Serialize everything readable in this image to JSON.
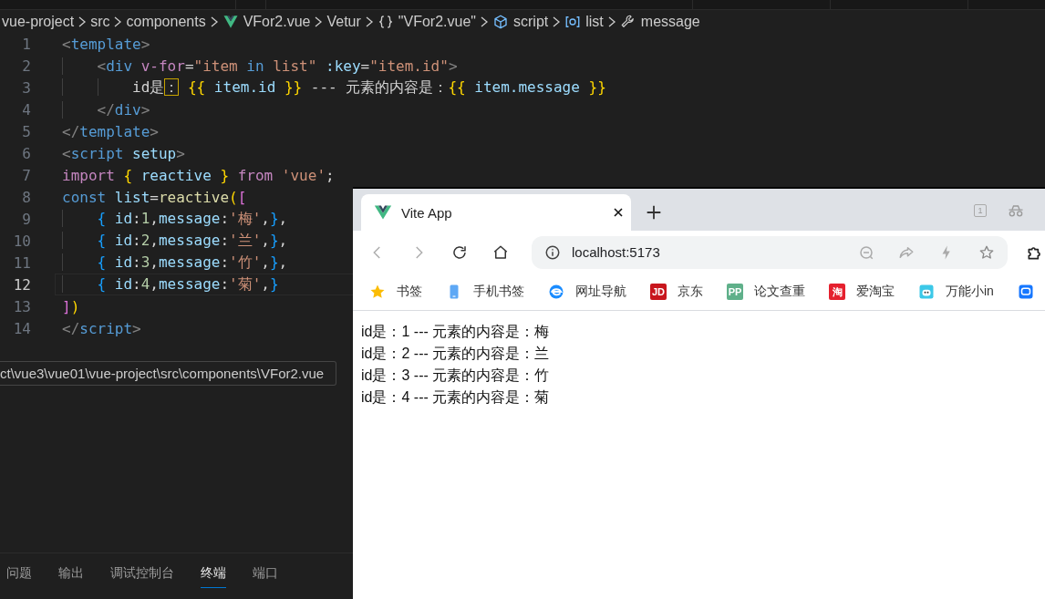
{
  "breadcrumb": [
    {
      "kind": "plain",
      "label": "vue-project"
    },
    {
      "kind": "plain",
      "label": "src"
    },
    {
      "kind": "plain",
      "label": "components"
    },
    {
      "kind": "vue",
      "label": "VFor2.vue"
    },
    {
      "kind": "plain",
      "label": "Vetur"
    },
    {
      "kind": "braces",
      "label": "\"VFor2.vue\""
    },
    {
      "kind": "cube",
      "label": "script"
    },
    {
      "kind": "array",
      "label": "list"
    },
    {
      "kind": "wrench",
      "label": "message"
    }
  ],
  "editor": {
    "lines": [
      {
        "number": "1",
        "current": false,
        "tokens": [
          {
            "kind": "bracket",
            "text": "<"
          },
          {
            "kind": "tag",
            "text": "template"
          },
          {
            "kind": "bracket",
            "text": ">"
          }
        ]
      },
      {
        "number": "2",
        "current": false,
        "tokens": [
          {
            "kind": "bracket",
            "text": "    <"
          },
          {
            "kind": "tag",
            "text": "div "
          },
          {
            "kind": "directive",
            "text": "v-for"
          },
          {
            "kind": "plain",
            "text": "="
          },
          {
            "kind": "string",
            "text": "\"item "
          },
          {
            "kind": "keyword",
            "text": "in"
          },
          {
            "kind": "string",
            "text": " list\" "
          },
          {
            "kind": "attr",
            "text": ":key"
          },
          {
            "kind": "plain",
            "text": "="
          },
          {
            "kind": "string",
            "text": "\"item.id\""
          },
          {
            "kind": "bracket",
            "text": ">"
          }
        ]
      },
      {
        "number": "3",
        "current": false,
        "tokens": [
          {
            "kind": "plain",
            "text": "        id是"
          },
          {
            "kind": "ambiguous",
            "text": "："
          },
          {
            "kind": "mustache",
            "text": " {{ "
          },
          {
            "kind": "variable",
            "text": "item.id"
          },
          {
            "kind": "mustache",
            "text": " }}"
          },
          {
            "kind": "plain",
            "text": " --- 元素的内容是："
          },
          {
            "kind": "mustache",
            "text": "{{ "
          },
          {
            "kind": "variable",
            "text": "item.message"
          },
          {
            "kind": "mustache",
            "text": " }}"
          }
        ]
      },
      {
        "number": "4",
        "current": false,
        "tokens": [
          {
            "kind": "bracket",
            "text": "    </"
          },
          {
            "kind": "tag",
            "text": "div"
          },
          {
            "kind": "bracket",
            "text": ">"
          }
        ]
      },
      {
        "number": "5",
        "current": false,
        "tokens": [
          {
            "kind": "bracket",
            "text": "</"
          },
          {
            "kind": "tag",
            "text": "template"
          },
          {
            "kind": "bracket",
            "text": ">"
          }
        ]
      },
      {
        "number": "6",
        "current": false,
        "tokens": [
          {
            "kind": "bracket",
            "text": "<"
          },
          {
            "kind": "tag",
            "text": "script "
          },
          {
            "kind": "attr",
            "text": "setup"
          },
          {
            "kind": "bracket",
            "text": ">"
          }
        ]
      },
      {
        "number": "7",
        "current": false,
        "tokens": [
          {
            "kind": "control",
            "text": "import "
          },
          {
            "kind": "paren1",
            "text": "{ "
          },
          {
            "kind": "variable",
            "text": "reactive "
          },
          {
            "kind": "paren1",
            "text": "} "
          },
          {
            "kind": "control",
            "text": "from "
          },
          {
            "kind": "string",
            "text": "'vue'"
          },
          {
            "kind": "plain",
            "text": ";"
          }
        ]
      },
      {
        "number": "8",
        "current": false,
        "tokens": [
          {
            "kind": "keyword",
            "text": "const "
          },
          {
            "kind": "variable",
            "text": "list"
          },
          {
            "kind": "plain",
            "text": "="
          },
          {
            "kind": "function",
            "text": "reactive"
          },
          {
            "kind": "paren1",
            "text": "("
          },
          {
            "kind": "paren2",
            "text": "["
          }
        ]
      },
      {
        "number": "9",
        "current": false,
        "tokens": [
          {
            "kind": "paren3",
            "text": "    { "
          },
          {
            "kind": "variable",
            "text": "id"
          },
          {
            "kind": "plain",
            "text": ":"
          },
          {
            "kind": "number",
            "text": "1"
          },
          {
            "kind": "plain",
            "text": ","
          },
          {
            "kind": "variable",
            "text": "message"
          },
          {
            "kind": "plain",
            "text": ":"
          },
          {
            "kind": "string",
            "text": "'梅'"
          },
          {
            "kind": "plain",
            "text": ","
          },
          {
            "kind": "paren3",
            "text": "}"
          },
          {
            "kind": "plain",
            "text": ","
          }
        ]
      },
      {
        "number": "10",
        "current": false,
        "tokens": [
          {
            "kind": "paren3",
            "text": "    { "
          },
          {
            "kind": "variable",
            "text": "id"
          },
          {
            "kind": "plain",
            "text": ":"
          },
          {
            "kind": "number",
            "text": "2"
          },
          {
            "kind": "plain",
            "text": ","
          },
          {
            "kind": "variable",
            "text": "message"
          },
          {
            "kind": "plain",
            "text": ":"
          },
          {
            "kind": "string",
            "text": "'兰'"
          },
          {
            "kind": "plain",
            "text": ","
          },
          {
            "kind": "paren3",
            "text": "}"
          },
          {
            "kind": "plain",
            "text": ","
          }
        ]
      },
      {
        "number": "11",
        "current": false,
        "tokens": [
          {
            "kind": "paren3",
            "text": "    { "
          },
          {
            "kind": "variable",
            "text": "id"
          },
          {
            "kind": "plain",
            "text": ":"
          },
          {
            "kind": "number",
            "text": "3"
          },
          {
            "kind": "plain",
            "text": ","
          },
          {
            "kind": "variable",
            "text": "message"
          },
          {
            "kind": "plain",
            "text": ":"
          },
          {
            "kind": "string",
            "text": "'竹'"
          },
          {
            "kind": "plain",
            "text": ","
          },
          {
            "kind": "paren3",
            "text": "}"
          },
          {
            "kind": "plain",
            "text": ","
          }
        ]
      },
      {
        "number": "12",
        "current": true,
        "tokens": [
          {
            "kind": "paren3",
            "text": "    { "
          },
          {
            "kind": "variable",
            "text": "id"
          },
          {
            "kind": "plain",
            "text": ":"
          },
          {
            "kind": "number",
            "text": "4"
          },
          {
            "kind": "plain",
            "text": ","
          },
          {
            "kind": "variable",
            "text": "message"
          },
          {
            "kind": "plain",
            "text": ":"
          },
          {
            "kind": "string",
            "text": "'菊'"
          },
          {
            "kind": "plain",
            "text": ","
          },
          {
            "kind": "paren3",
            "text": "}"
          }
        ]
      },
      {
        "number": "13",
        "current": false,
        "tokens": [
          {
            "kind": "paren2",
            "text": "]"
          },
          {
            "kind": "paren1",
            "text": ")"
          }
        ]
      },
      {
        "number": "14",
        "current": false,
        "tokens": [
          {
            "kind": "bracket",
            "text": "</"
          },
          {
            "kind": "tag",
            "text": "script"
          },
          {
            "kind": "bracket",
            "text": ">"
          }
        ]
      }
    ]
  },
  "tooltip": "ct\\vue3\\vue01\\vue-project\\src\\components\\VFor2.vue",
  "panel_tabs": [
    {
      "label": "问题",
      "selected": false
    },
    {
      "label": "输出",
      "selected": false
    },
    {
      "label": "调试控制台",
      "selected": false
    },
    {
      "label": "终端",
      "selected": true
    },
    {
      "label": "端口",
      "selected": false
    }
  ],
  "browser": {
    "tab": {
      "title": "Vite App"
    },
    "tab_counter": "1",
    "address": "localhost:5173",
    "bookmarks": [
      {
        "kind": "star",
        "label": "书签"
      },
      {
        "kind": "phone",
        "label": "手机书签"
      },
      {
        "kind": "globe",
        "label": "网址导航"
      },
      {
        "kind": "badge",
        "badge": "JD",
        "color": "#c8161d",
        "label": "京东"
      },
      {
        "kind": "badge",
        "badge": "PP",
        "color": "#5fb08a",
        "label": "论文查重"
      },
      {
        "kind": "badge",
        "badge": "淘",
        "color": "#e5202e",
        "label": "爱淘宝"
      },
      {
        "kind": "robot",
        "label": "万能小in"
      },
      {
        "kind": "chat"
      }
    ],
    "content": [
      "id是：1 --- 元素的内容是：梅",
      "id是：2 --- 元素的内容是：兰",
      "id是：3 --- 元素的内容是：竹",
      "id是：4 --- 元素的内容是：菊"
    ]
  }
}
